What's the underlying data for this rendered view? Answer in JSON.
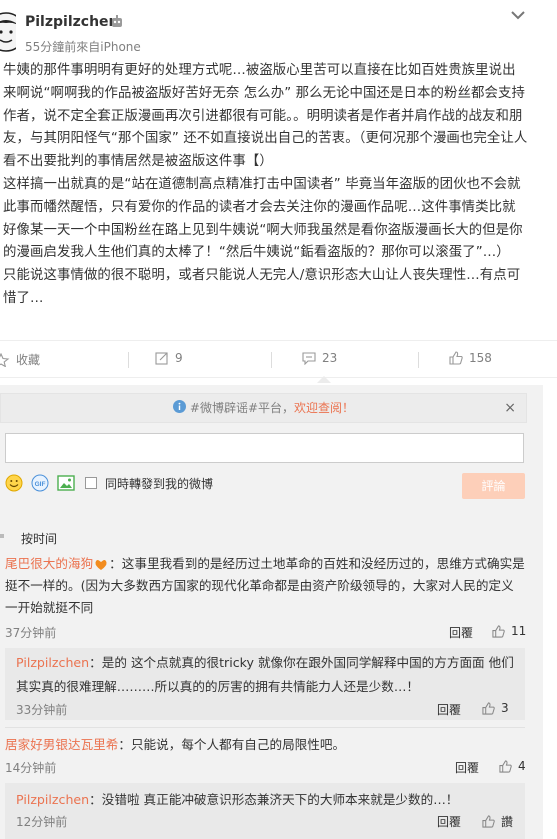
{
  "post": {
    "username": "Pilzpilzchen",
    "meta": "55分鐘前來自iPhone",
    "body": [
      "牛姨的那件事明明有更好的处理方式呢…被盗版心里苦可以直接在比如百姓贵族里说出来啊说“啊啊我的作品被盗版好苦好无奈 怎么办” 那么无论中国还是日本的粉丝都会支持作者，说不定全套正版漫画再次引进都很有可能。。明明读者是作者并肩作战的战友和朋友，与其阴阳怪气“那个国家” 还不如直接说出自己的苦衷。（更何况那个漫画也完全让人看不出要批判的事情居然是被盗版这件事【）",
      "这样搞一出就真的是“站在道德制高点精准打击中国读者” 毕竟当年盗版的团伙也不会就此事而幡然醒悟，只有爱你的作品的读者才会去关注你的漫画作品呢…这件事情类比就好像某一天一个中国粉丝在路上见到牛姨说“啊大师我虽然是看你盗版漫画长大的但是你的漫画启发我人生他们真的太棒了！“然后牛姨说“銗看盗版的？那你可以滚蛋了”…）",
      "只能说这事情做的很不聪明，或者只能说人无完人/意识形态大山让人丧失理性…有点可惜了…"
    ]
  },
  "actions": {
    "favorite": "收藏",
    "repost_count": "9",
    "comment_count": "23",
    "like_count": "158"
  },
  "notice": {
    "prefix": "#微博辟谣#平台，",
    "highlight": "欢迎查阅！",
    "close": "×"
  },
  "composer": {
    "repost_label": "同時轉發到我的微博",
    "submit_label": "評論"
  },
  "sort": {
    "label": "按时间"
  },
  "comments": [
    {
      "nick": "尾巴很大的海狗",
      "text": "：这事里我看到的是经历过土地革命的百姓和没经历过的，思维方式确实是挺不一样的。(因为大多数西方国家的现代化革命都是由资产阶级领导的，大家对人民的定义一开始就挺不同",
      "time": "37分钟前",
      "reply": "回覆",
      "likes": "11"
    },
    {
      "nick": "Pilzpilzchen",
      "text": "：是的 这个点就真的很tricky 就像你在跟外国同学解释中国的方方面面 他们其实真的很难理解………所以真的的厉害的拥有共情能力人还是少数…！",
      "time": "33分钟前",
      "reply": "回覆",
      "likes": "3"
    },
    {
      "nick": "居家好男银达瓦里希",
      "text": "：只能说，每个人都有自己的局限性吧。",
      "time": "14分钟前",
      "reply": "回覆",
      "likes": "4"
    },
    {
      "nick": "Pilzpilzchen",
      "text": "：没错啦 真正能冲破意识形态兼济天下的大师本来就是少数的…！",
      "time": "12分钟前",
      "reply": "回覆",
      "likes": "讚"
    }
  ],
  "colors": {
    "accent": "#eb7350",
    "muted": "#808080",
    "submit_bg": "#fdcfb9",
    "panel_bg": "#f2f2f2"
  }
}
